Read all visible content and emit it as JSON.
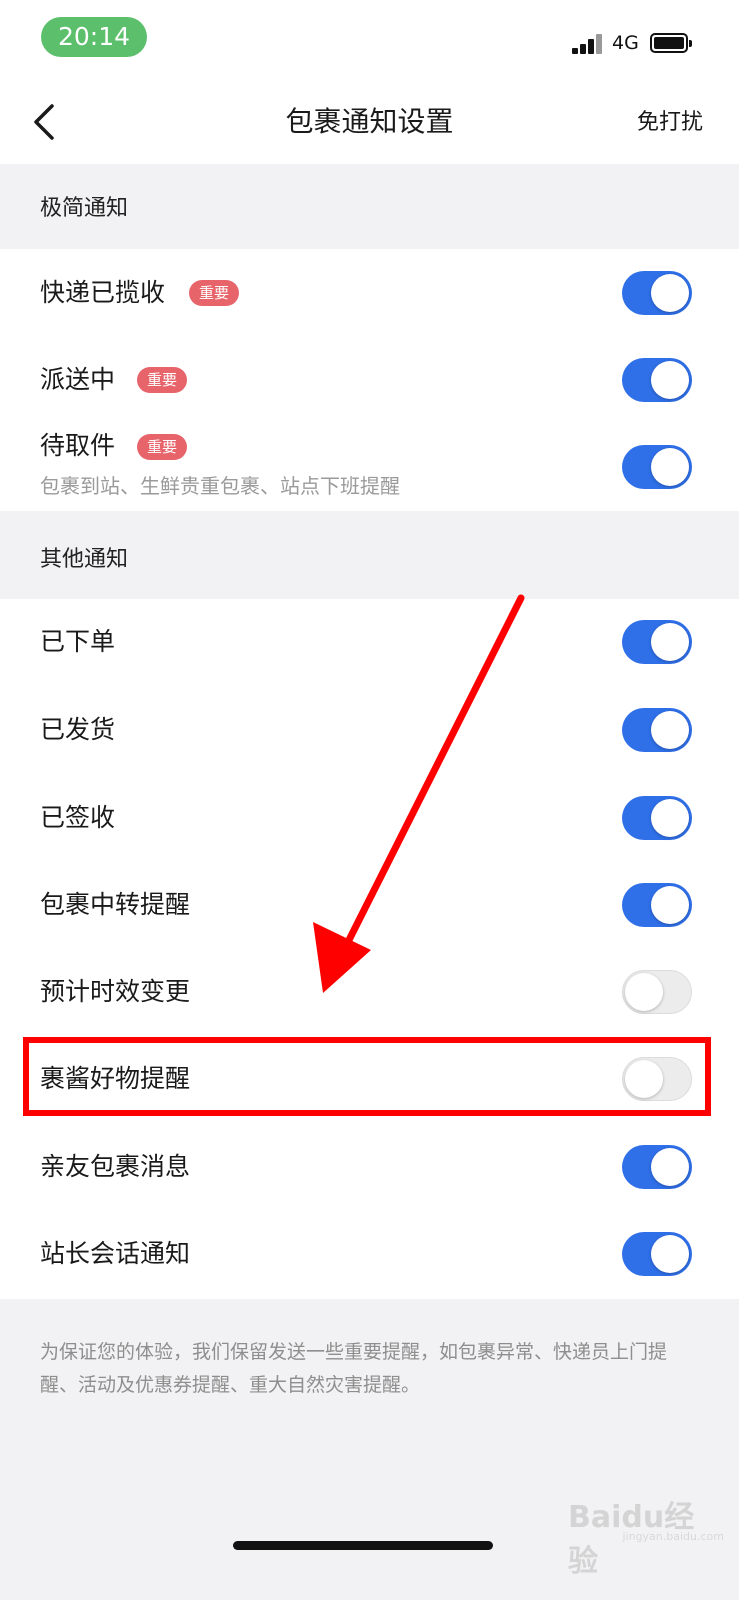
{
  "status_bar": {
    "time": "20:14",
    "network": "4G",
    "time_pill_color": "#5bbf6c"
  },
  "nav": {
    "back_icon": "chevron-left-icon",
    "title": "包裹通知设置",
    "right_action": "免打扰"
  },
  "sections": {
    "simple": {
      "title": "极简通知",
      "rows": [
        {
          "label": "快递已揽收",
          "badge": "重要",
          "enabled": true
        },
        {
          "label": "派送中",
          "badge": "重要",
          "enabled": true
        },
        {
          "label": "待取件",
          "badge": "重要",
          "subtitle": "包裹到站、生鲜贵重包裹、站点下班提醒",
          "enabled": true
        }
      ]
    },
    "other": {
      "title": "其他通知",
      "rows": [
        {
          "label": "已下单",
          "enabled": true
        },
        {
          "label": "已发货",
          "enabled": true
        },
        {
          "label": "已签收",
          "enabled": true
        },
        {
          "label": "包裹中转提醒",
          "enabled": true
        },
        {
          "label": "预计时效变更",
          "enabled": false
        },
        {
          "label": "裹酱好物提醒",
          "enabled": false
        },
        {
          "label": "亲友包裹消息",
          "enabled": true
        },
        {
          "label": "站长会话通知",
          "enabled": true
        }
      ]
    }
  },
  "footer_note": "为保证您的体验，我们保留发送一些重要提醒，如包裹异常、快递员上门提醒、活动及优惠券提醒、重大自然灾害提醒。",
  "watermark": {
    "text": "Baidu经验",
    "sub": "jingyan.baidu.com"
  },
  "colors": {
    "toggle_on": "#2f6fe8",
    "toggle_off": "#ececec",
    "badge": "#e8646b",
    "annotation": "#ff0000",
    "background": "#f2f2f4"
  }
}
